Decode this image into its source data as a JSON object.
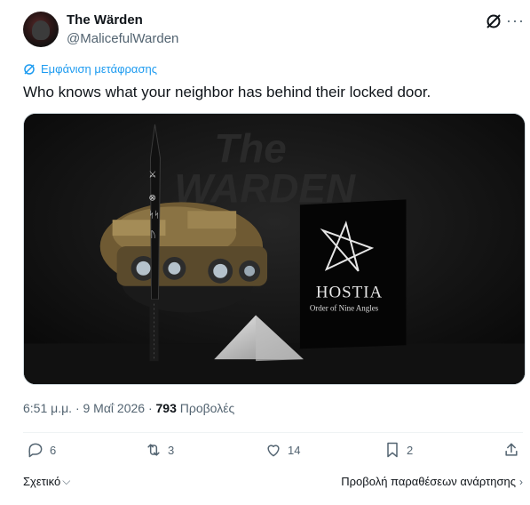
{
  "author": {
    "display_name": "The Wärden",
    "handle": "@MalicefulWarden"
  },
  "translate_label": "Εμφάνιση μετάφρασης",
  "tweet_text": "Who knows what your neighbor has behind their locked door.",
  "media": {
    "watermark_line1": "The",
    "watermark_line2": "WARDEN",
    "book_title": "HOSTIA",
    "book_subtitle": "Order of Nine Angles"
  },
  "meta": {
    "time_date": "6:51 μ.μ. · 9 Μαΐ 2026 · ",
    "views_count": "793",
    "views_label": " Προβολές"
  },
  "actions": {
    "replies": "6",
    "reposts": "3",
    "likes": "14",
    "bookmarks": "2"
  },
  "footer": {
    "related_label": "Σχετικό",
    "quotes_label": "Προβολή παραθέσεων ανάρτησης"
  },
  "colors": {
    "accent": "#1d9bf0",
    "secondary_text": "#536471",
    "primary_text": "#0f1419"
  }
}
